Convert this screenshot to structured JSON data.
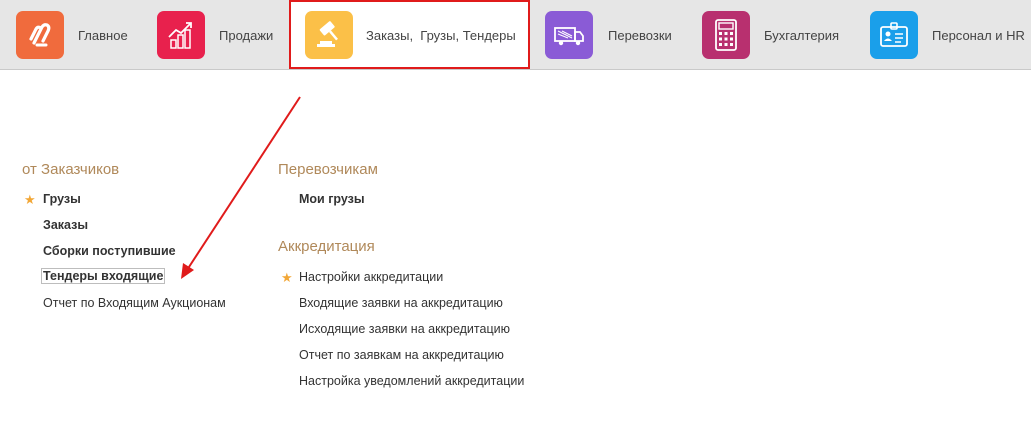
{
  "nav": {
    "items": [
      {
        "label": "Главное",
        "icon": "logo-icon",
        "color": "#f06b3d"
      },
      {
        "label": "Продажи",
        "icon": "sales-chart-icon",
        "color": "#e8214d"
      },
      {
        "label": "Заказы,  Грузы, Тендеры",
        "icon": "gavel-icon",
        "color": "#fbc048"
      },
      {
        "label": "Перевозки",
        "icon": "truck-icon",
        "color": "#8a5bd6"
      },
      {
        "label": "Бухгалтерия",
        "icon": "calculator-icon",
        "color": "#b8306f"
      },
      {
        "label": "Персонал и HR",
        "icon": "id-badge-icon",
        "color": "#1a9fea"
      }
    ],
    "active_index": 2,
    "highlight_color": "#e01b1b"
  },
  "sections": {
    "customers": {
      "title": "от Заказчиков",
      "items": [
        {
          "label": "Грузы",
          "starred": true
        },
        {
          "label": "Заказы"
        },
        {
          "label": "Сборки поступившие"
        },
        {
          "label": "Тендеры входящие"
        },
        {
          "label": "Отчет по Входящим Аукционам"
        }
      ]
    },
    "carriers": {
      "title": "Перевозчикам",
      "items": [
        {
          "label": "Мои грузы"
        }
      ]
    },
    "accreditation": {
      "title": "Аккредитация",
      "items": [
        {
          "label": "Настройки аккредитации",
          "starred": true
        },
        {
          "label": "Входящие заявки на аккредитацию"
        },
        {
          "label": "Исходящие заявки на аккредитацию"
        },
        {
          "label": "Отчет по заявкам на аккредитацию"
        },
        {
          "label": "Настройка уведомлений аккредитации"
        }
      ]
    }
  },
  "colors": {
    "section_title": "#b0895a",
    "star": "#f2a737",
    "annotation_arrow": "#e01b1b"
  }
}
